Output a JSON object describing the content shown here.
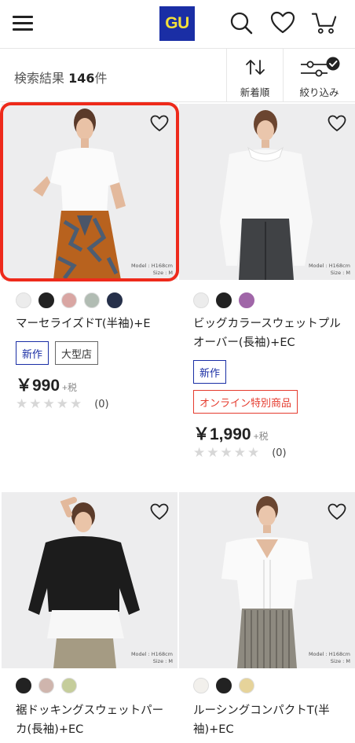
{
  "header": {
    "logo_text": "GU",
    "logo_bg": "#1a2ea5",
    "logo_fg": "#f3e03a",
    "icons": [
      "menu-icon",
      "search-icon",
      "heart-icon",
      "cart-icon"
    ]
  },
  "results": {
    "label": "検索結果",
    "count": "146",
    "unit": "件",
    "sort_label": "新着順",
    "filter_label": "絞り込み"
  },
  "products": [
    {
      "name": "マーセライズドT(半袖)+E",
      "swatches": [
        "#ececec",
        "#222222",
        "#d9a6a3",
        "#b1bcb3",
        "#26304a"
      ],
      "tags": [
        "新作",
        "大型店"
      ],
      "price": "￥990",
      "tax": "+税",
      "reviews": "(0)",
      "model_note_1": "Model : H168cm",
      "model_note_2": "Size : M",
      "selected": true
    },
    {
      "name": "ビッグカラースウェットプルオーバー(長袖)+EC",
      "swatches": [
        "#ececec",
        "#222222",
        "#a066a8"
      ],
      "tags": [
        "新作"
      ],
      "online_tag": "オンライン特別商品",
      "price": "￥1,990",
      "tax": "+税",
      "reviews": "(0)",
      "model_note_1": "Model : H168cm",
      "model_note_2": "Size : M",
      "selected": false
    },
    {
      "name": "裾ドッキングスウェットパーカ(長袖)+EC",
      "swatches": [
        "#222222",
        "#cfb5ad",
        "#c5cd9b"
      ],
      "model_note_1": "Model : H168cm",
      "model_note_2": "Size : M",
      "selected": false
    },
    {
      "name": "ルーシングコンパクトT(半袖)+EC",
      "swatches": [
        "#f2f0ec",
        "#222222",
        "#e6d39a"
      ],
      "model_note_1": "Model : H168cm",
      "model_note_2": "Size : M",
      "selected": false
    }
  ],
  "colors": {
    "accent_blue": "#1a2ea5",
    "sale_red": "#e53b2e",
    "selection_red": "#ee2a1b"
  }
}
